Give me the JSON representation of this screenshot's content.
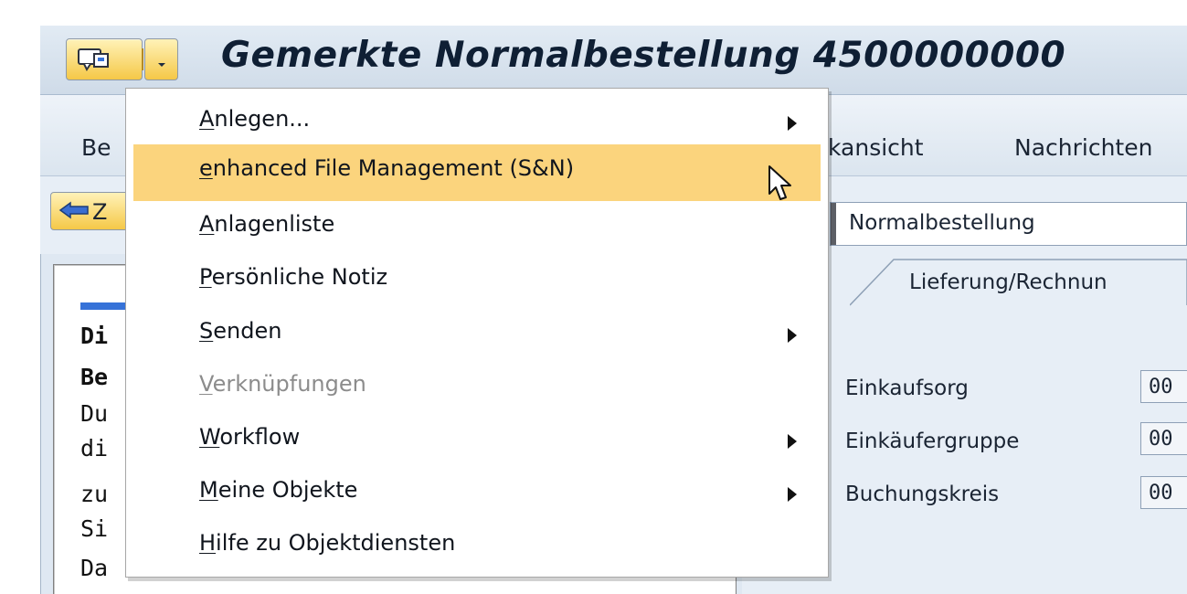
{
  "window": {
    "title": "Gemerkte Normalbestellung 4500000000"
  },
  "menubar": {
    "items": [
      "Be",
      "kansicht",
      "Nachrichten"
    ]
  },
  "toolbar": {
    "back_button_label": "Z"
  },
  "context_menu": {
    "items": [
      {
        "mnemonic": "A",
        "rest": "nlegen...",
        "submenu": true,
        "highlighted": false,
        "disabled": false
      },
      {
        "mnemonic": "e",
        "rest": "nhanced File Management (S&N)",
        "submenu": false,
        "highlighted": true,
        "disabled": false
      },
      {
        "mnemonic": "A",
        "rest": "nlagenliste",
        "submenu": false,
        "highlighted": false,
        "disabled": false
      },
      {
        "mnemonic": "P",
        "rest": "ersönliche Notiz",
        "submenu": false,
        "highlighted": false,
        "disabled": false
      },
      {
        "mnemonic": "S",
        "rest": "enden",
        "submenu": true,
        "highlighted": false,
        "disabled": false
      },
      {
        "mnemonic": "V",
        "rest": "erknüpfungen",
        "submenu": false,
        "highlighted": false,
        "disabled": true
      },
      {
        "mnemonic": "W",
        "rest": "orkflow",
        "submenu": true,
        "highlighted": false,
        "disabled": false
      },
      {
        "mnemonic": "M",
        "rest": "eine Objekte",
        "submenu": true,
        "highlighted": false,
        "disabled": false
      },
      {
        "mnemonic": "H",
        "rest": "ilfe zu Objektdiensten",
        "submenu": false,
        "highlighted": false,
        "disabled": false
      }
    ]
  },
  "left_pane": {
    "lines": [
      {
        "text": "Di",
        "bold": true
      },
      {
        "text": "Be",
        "bold": true
      },
      {
        "text": "Du",
        "bold": false
      },
      {
        "text": "di",
        "bold": false
      },
      {
        "text": "zu",
        "bold": false
      },
      {
        "text": "Si",
        "bold": false
      },
      {
        "text": "Da",
        "bold": false
      }
    ]
  },
  "right_pane": {
    "document_type": "Normalbestellung",
    "tab": "Lieferung/Rechnun",
    "fields": [
      {
        "label": "Einkaufsorg",
        "value": "00"
      },
      {
        "label": "Einkäufergruppe",
        "value": "00"
      },
      {
        "label": "Buchungskreis",
        "value": "00"
      }
    ]
  },
  "icons": {
    "system_menu": "system-menu-icon",
    "dropdown": "chevron-down-icon",
    "back": "arrow-left-icon",
    "submenu": "chevron-right-icon",
    "cursor": "mouse-pointer-icon"
  },
  "colors": {
    "highlight": "#fbd47d",
    "button_gold": "#f5c847",
    "accent_blue": "#3672d8"
  }
}
